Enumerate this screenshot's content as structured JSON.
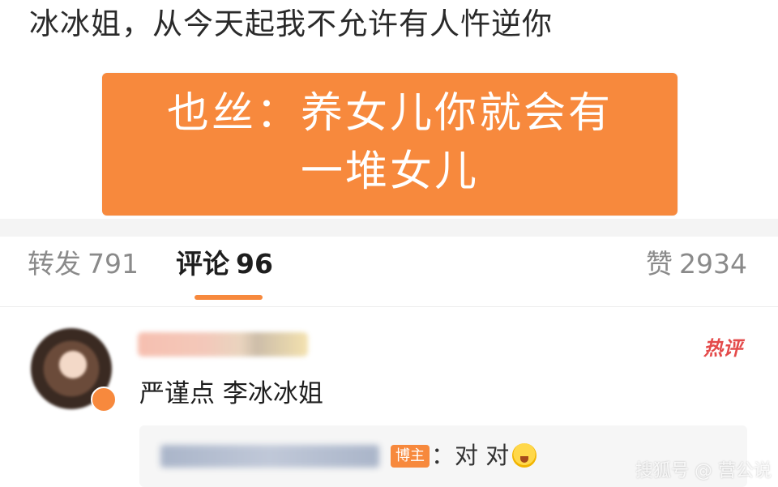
{
  "post": {
    "text": "冰冰姐，从今天起我不允许有人忤逆你",
    "image_caption_line1": "也丝：养女儿你就会有",
    "image_caption_line2": "一堆女儿"
  },
  "tabs": {
    "repost_label": "转发",
    "repost_count": "791",
    "comments_label": "评论",
    "comments_count": "96",
    "likes_label": "赞",
    "likes_count": "2934"
  },
  "comment": {
    "hot_tag": "热评",
    "text": "严谨点 李冰冰姐",
    "reply": {
      "badge": "博主",
      "text": "：对 对",
      "emoji": "laughing-sweat-emoji"
    }
  },
  "watermark": "搜狐号 @ 营公说",
  "colors": {
    "accent": "#f7893d",
    "hot_tag": "#e44a4a"
  }
}
